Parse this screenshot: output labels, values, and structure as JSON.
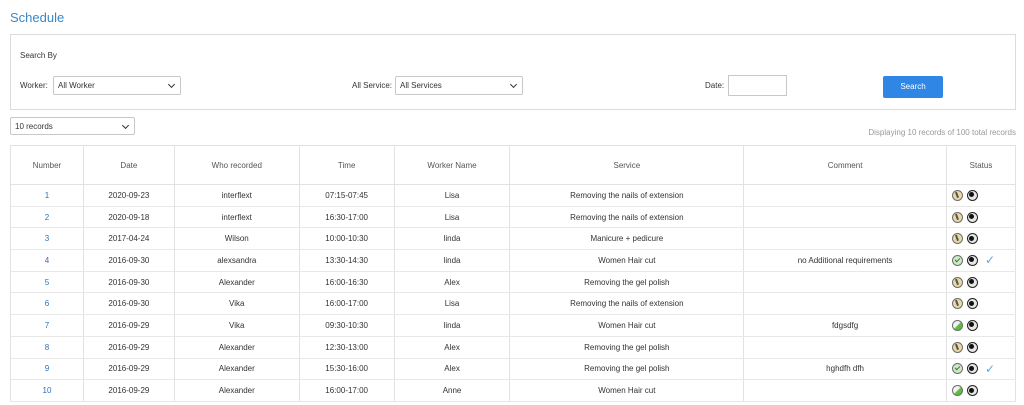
{
  "page": {
    "title": "Schedule"
  },
  "search": {
    "heading": "Search By",
    "worker_label": "Worker:",
    "worker_value": "All Worker",
    "service_label": "All Service:",
    "service_value": "All Services",
    "date_label": "Date:",
    "date_value": "",
    "button": "Search"
  },
  "records": {
    "per_page": "10 records",
    "summary": "Displaying 10 records of 100 total records"
  },
  "table": {
    "headers": [
      "Number",
      "Date",
      "Who recorded",
      "Time",
      "Worker Name",
      "Service",
      "Comment",
      "Status"
    ],
    "rows": [
      {
        "number": "1",
        "date": "2020-09-23",
        "who": "interflext",
        "time": "07:15-07:45",
        "worker": "Lisa",
        "service": "Removing the nails of extension",
        "comment": "",
        "status": "pending-icon",
        "confirmed": false
      },
      {
        "number": "2",
        "date": "2020-09-18",
        "who": "interflext",
        "time": "16:30-17:00",
        "worker": "Lisa",
        "service": "Removing the nails of extension",
        "comment": "",
        "status": "pending-icon",
        "confirmed": false
      },
      {
        "number": "3",
        "date": "2017-04-24",
        "who": "Wilson",
        "time": "10:00-10:30",
        "worker": "linda",
        "service": "Manicure + pedicure",
        "comment": "",
        "status": "pending-icon",
        "confirmed": false
      },
      {
        "number": "4",
        "date": "2016-09-30",
        "who": "alexsandra",
        "time": "13:30-14:30",
        "worker": "linda",
        "service": "Women Hair cut",
        "comment": "no Additional requirements",
        "status": "approved-icon",
        "confirmed": true
      },
      {
        "number": "5",
        "date": "2016-09-30",
        "who": "Alexander",
        "time": "16:00-16:30",
        "worker": "Alex",
        "service": "Removing the gel polish",
        "comment": "",
        "status": "pending-icon",
        "confirmed": false
      },
      {
        "number": "6",
        "date": "2016-09-30",
        "who": "Vika",
        "time": "16:00-17:00",
        "worker": "Lisa",
        "service": "Removing the nails of extension",
        "comment": "",
        "status": "pending-icon",
        "confirmed": false
      },
      {
        "number": "7",
        "date": "2016-09-29",
        "who": "Vika",
        "time": "09:30-10:30",
        "worker": "linda",
        "service": "Women Hair cut",
        "comment": "fdgsdfg",
        "status": "done-icon",
        "confirmed": false
      },
      {
        "number": "8",
        "date": "2016-09-29",
        "who": "Alexander",
        "time": "12:30-13:00",
        "worker": "Alex",
        "service": "Removing the gel polish",
        "comment": "",
        "status": "pending-icon",
        "confirmed": false
      },
      {
        "number": "9",
        "date": "2016-09-29",
        "who": "Alexander",
        "time": "15:30-16:00",
        "worker": "Alex",
        "service": "Removing the gel polish",
        "comment": "hghdfh dfh",
        "status": "approved-icon",
        "confirmed": true
      },
      {
        "number": "10",
        "date": "2016-09-29",
        "who": "Alexander",
        "time": "16:00-17:00",
        "worker": "Anne",
        "service": "Women Hair cut",
        "comment": "",
        "status": "done-icon",
        "confirmed": false
      }
    ]
  },
  "colors": {
    "accent": "#2f86e5",
    "title": "#3a87c8",
    "link": "#2d6fbf",
    "check": "#5aa6e8"
  }
}
